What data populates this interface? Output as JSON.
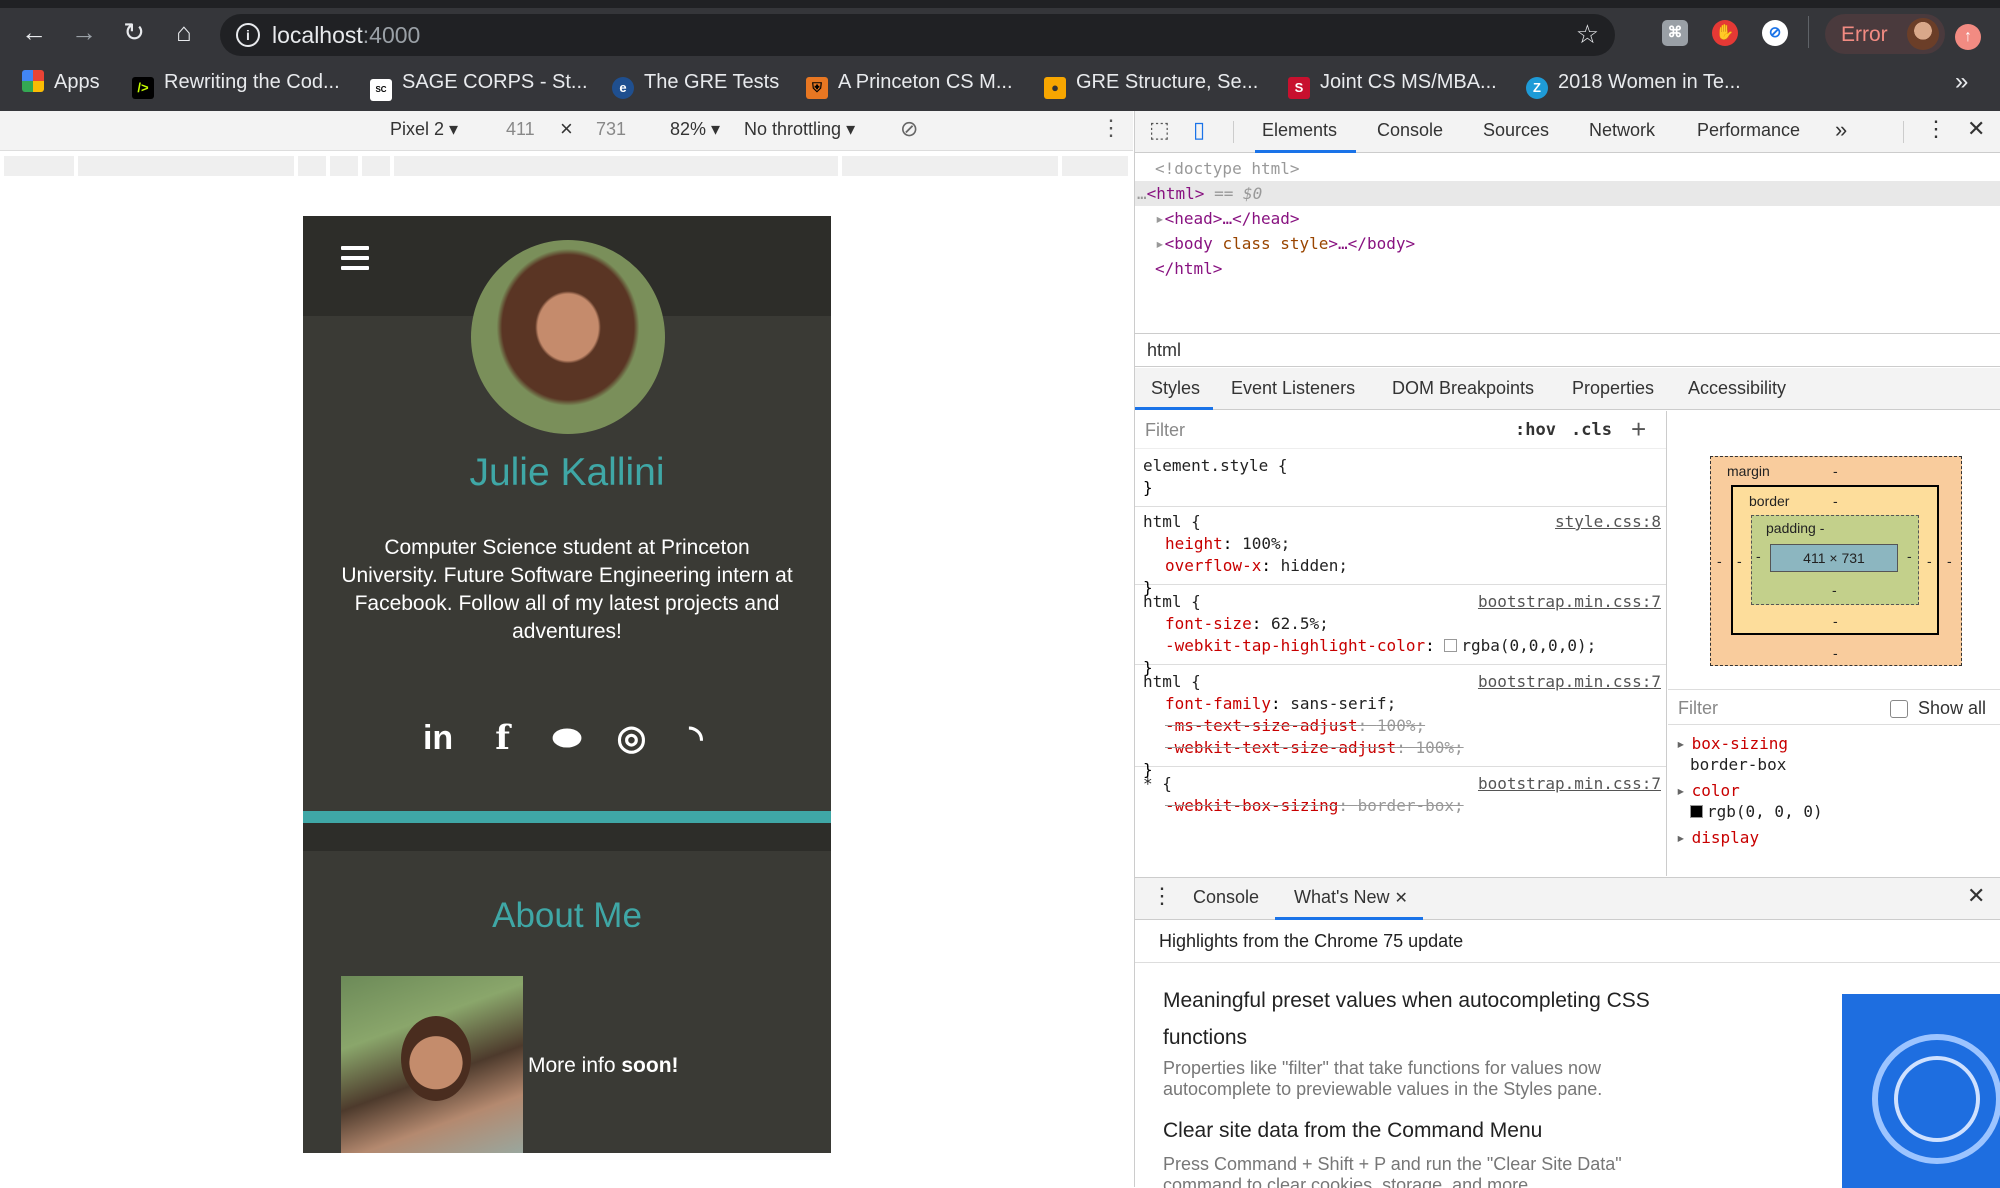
{
  "browser": {
    "url_host": "localhost",
    "url_port": ":4000",
    "error_label": "Error",
    "bookmarks": [
      {
        "label": "Apps",
        "icon": "apps-grid-icon"
      },
      {
        "label": "Rewriting the Cod...",
        "icon": "rewriting-code-icon"
      },
      {
        "label": "SAGE CORPS - St...",
        "icon": "sage-corps-icon"
      },
      {
        "label": "The GRE Tests",
        "icon": "ets-icon"
      },
      {
        "label": "A Princeton CS M...",
        "icon": "princeton-shield-icon"
      },
      {
        "label": "GRE Structure, Se...",
        "icon": "gre-person-icon"
      },
      {
        "label": "Joint CS MS/MBA...",
        "icon": "stanford-s-icon"
      },
      {
        "label": "2018 Women in Te...",
        "icon": "z-circle-icon"
      }
    ],
    "more_bookmarks": "»"
  },
  "device_toolbar": {
    "device": "Pixel 2",
    "width": "411",
    "times": "×",
    "height": "731",
    "zoom": "82%",
    "throttling": "No throttling"
  },
  "site": {
    "name": "Julie Kallini",
    "bio": "Computer Science student at Princeton University. Future Software Engineering intern at Facebook. Follow all of my latest projects and adventures!",
    "social": [
      {
        "icon": "linkedin-icon",
        "glyph": "in"
      },
      {
        "icon": "facebook-icon",
        "glyph": "f"
      },
      {
        "icon": "github-icon",
        "glyph": "⬬"
      },
      {
        "icon": "instagram-icon",
        "glyph": "◎"
      },
      {
        "icon": "rss-icon",
        "glyph": "◝"
      }
    ],
    "about_title": "About Me",
    "about_text": "More info ",
    "about_text_bold": "soon!"
  },
  "devtools": {
    "tabs": [
      "Elements",
      "Console",
      "Sources",
      "Network",
      "Performance"
    ],
    "more_tabs": "»",
    "dom": {
      "doctype": "<!doctype html>",
      "html_open": "<html>",
      "selected_marker": "== $0",
      "head": "<head>…</head>",
      "body_tag": "<body",
      "body_attrs": " class style",
      "body_rest": ">…</body>",
      "html_close": "</html>"
    },
    "breadcrumb": "html",
    "subtabs": [
      "Styles",
      "Event Listeners",
      "DOM Breakpoints",
      "Properties",
      "Accessibility"
    ],
    "styles_filter_placeholder": "Filter",
    "hov": ":hov",
    "cls": ".cls",
    "rules": [
      {
        "selector": "element.style {",
        "source": "",
        "decls": []
      },
      {
        "selector": "html {",
        "source": "style.css:8",
        "decls": [
          {
            "prop": "height",
            "value": "100%;",
            "struck": false
          },
          {
            "prop": "overflow-x",
            "value": "hidden;",
            "struck": false
          }
        ]
      },
      {
        "selector": "html {",
        "source": "bootstrap.min.css:7",
        "decls": [
          {
            "prop": "font-size",
            "value": "62.5%;",
            "struck": false
          },
          {
            "prop": "-webkit-tap-highlight-color",
            "value": "rgba(0,0,0,0);",
            "struck": false
          }
        ]
      },
      {
        "selector": "html {",
        "source": "bootstrap.min.css:7",
        "decls": [
          {
            "prop": "font-family",
            "value": "sans-serif;",
            "struck": false
          },
          {
            "prop": "-ms-text-size-adjust",
            "value": "100%;",
            "struck": true
          },
          {
            "prop": "-webkit-text-size-adjust",
            "value": "100%;",
            "struck": true
          }
        ]
      },
      {
        "selector": "* {",
        "source": "bootstrap.min.css:7",
        "decls": [
          {
            "prop": "-webkit-box-sizing",
            "value": "border-box;",
            "struck": true
          }
        ]
      }
    ],
    "boxmodel": {
      "margin": "margin",
      "border": "border",
      "padding": "padding",
      "dash": "-",
      "content": "411 × 731"
    },
    "computed_filter_placeholder": "Filter",
    "show_all": "Show all",
    "computed": [
      {
        "prop": "box-sizing",
        "value": "border-box"
      },
      {
        "prop": "color",
        "value": "rgb(0, 0, 0)"
      },
      {
        "prop": "display",
        "value": ""
      }
    ],
    "drawer_tabs": [
      "Console",
      "What's New"
    ],
    "whats_new_header": "Highlights from the Chrome 75 update",
    "whats_new": [
      {
        "title": "Meaningful preset values when autocompleting CSS functions",
        "desc": "Properties like \"filter\" that take functions for values now autocomplete to previewable values in the Styles pane."
      },
      {
        "title": "Clear site data from the Command Menu",
        "desc": "Press Command + Shift + P and run the \"Clear Site Data\" command to clear cookies, storage, and more."
      }
    ]
  },
  "colors": {
    "accent_teal": "#3fa7a6",
    "site_bg": "#3a3a35",
    "chrome_dark": "#35363a",
    "devtools_blue": "#1a73e8"
  }
}
